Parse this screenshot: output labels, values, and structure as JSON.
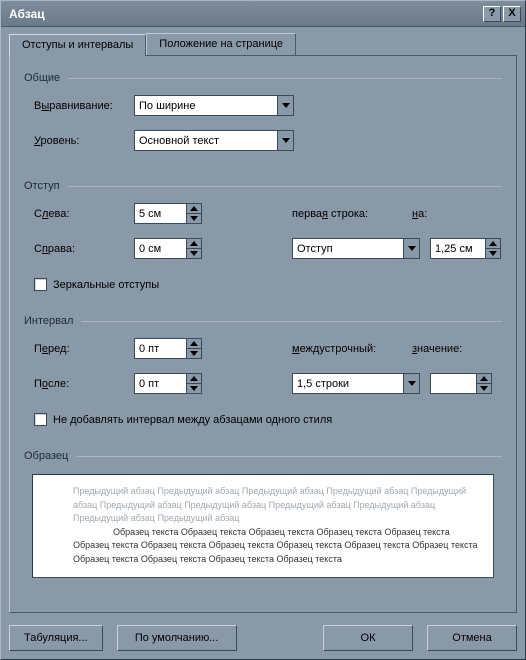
{
  "titlebar": {
    "title": "Абзац",
    "help": "?",
    "close": "X"
  },
  "tabs": {
    "t0": "Отступы и интервалы",
    "t1": "Положение на странице"
  },
  "group_general": "Общие",
  "alignment_label_pre": "В",
  "alignment_label_und": "ы",
  "alignment_label_post": "равнивание:",
  "alignment_value": "По ширине",
  "level_label_pre": "",
  "level_label_und": "У",
  "level_label_post": "ровень:",
  "level_value": "Основной текст",
  "group_indent": "Отступ",
  "left_label_pre": "С",
  "left_label_und": "л",
  "left_label_post": "ева:",
  "left_value": "5 см",
  "right_label_pre": "С",
  "right_label_und": "п",
  "right_label_post": "рава:",
  "right_value": "0 см",
  "firstline_label_pre": "перва",
  "firstline_label_und": "я",
  "firstline_label_post": " строка:",
  "firstline_value": "Отступ",
  "by_label_pre": "",
  "by_label_und": "н",
  "by_label_post": "а:",
  "by_value": "1,25 см",
  "mirror_label": "Зеркальные отступы",
  "group_spacing": "Интервал",
  "before_label_pre": "П",
  "before_label_und": "е",
  "before_label_post": "ред:",
  "before_value": "0 пт",
  "after_label_pre": "П",
  "after_label_und": "о",
  "after_label_post": "сле:",
  "after_value": "0 пт",
  "linespacing_label_pre": "",
  "linespacing_label_und": "м",
  "linespacing_label_post": "еждустрочный:",
  "linespacing_value": "1,5 строки",
  "value_label_pre": "",
  "value_label_und": "з",
  "value_label_post": "начение:",
  "value_value": "",
  "nospace_label": "Не добавлять интервал между абзацами одного стиля",
  "group_preview": "Образец",
  "preview_prev": "Предыдущий абзац Предыдущий абзац Предыдущий абзац Предыдущий абзац Предыдущий абзац Предыдущий абзац Предыдущий абзац Предыдущий абзац Предыдущий абзац Предыдущий абзац Предыдущий абзац",
  "preview_body": "Образец текста Образец текста Образец текста Образец текста Образец текста Образец текста Образец текста Образец текста Образец текста Образец текста Образец текста Образец текста Образец текста Образец текста Образец текста",
  "buttons": {
    "tabs": "Табуляция...",
    "default": "По умолчанию...",
    "ok": "ОК",
    "cancel": "Отмена"
  }
}
